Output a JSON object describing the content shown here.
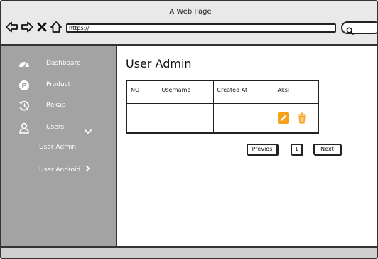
{
  "window": {
    "title": "A Web Page",
    "url": "https://"
  },
  "browser": {
    "nav_icons": [
      "back-arrow-icon",
      "forward-arrow-icon",
      "close-icon",
      "home-icon"
    ],
    "search_icon": "search-icon"
  },
  "sidebar": {
    "bg_color": "#a3a3a3",
    "items": [
      {
        "label": "Dashboard",
        "icon": "dashboard-gauge-icon"
      },
      {
        "label": "Product",
        "icon": "product-p-icon"
      },
      {
        "label": "Rekap",
        "icon": "history-icon"
      },
      {
        "label": "Users",
        "icon": "user-icon",
        "expanded": true
      }
    ],
    "sub_items": [
      {
        "label": "User Admin"
      },
      {
        "label": "User Android",
        "icon": "chevron-right-icon"
      }
    ]
  },
  "main": {
    "title": "User Admin",
    "table": {
      "columns": [
        "NO",
        "Username",
        "Created At",
        "Aksi"
      ],
      "rows": [
        {
          "no": "",
          "username": "",
          "created_at": "",
          "actions": [
            "edit-icon",
            "delete-icon"
          ]
        }
      ]
    },
    "pagination": {
      "prev_label": "Previos",
      "page": "1",
      "next_label": "Next"
    }
  },
  "colors": {
    "action_accent": "#f5a21b"
  }
}
